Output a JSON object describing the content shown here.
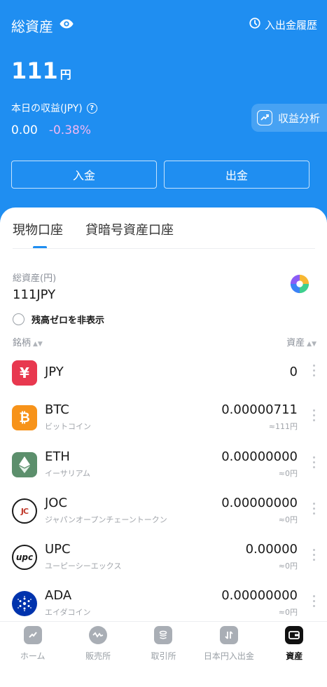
{
  "header": {
    "title": "総資産",
    "history_label": "入出金履歴",
    "balance": "111",
    "balance_unit": "円",
    "pl_label": "本日の収益(JPY)",
    "pl_value": "0.00",
    "pl_rate": "-0.38%",
    "analysis_label": "収益分析",
    "deposit_label": "入金",
    "withdraw_label": "出金"
  },
  "tabs": [
    "現物口座",
    "貸暗号資産口座"
  ],
  "summary": {
    "total_label": "総資産(円)",
    "total_value": "111JPY",
    "hide_zero_label": "残高ゼロを非表示"
  },
  "columns": {
    "name": "銘柄",
    "asset": "資産"
  },
  "assets": [
    {
      "symbol": "JPY",
      "name": "",
      "amount": "0",
      "fiat": "",
      "icon": "yen-icon",
      "color": "#e8384f"
    },
    {
      "symbol": "BTC",
      "name": "ビットコイン",
      "amount": "0.00000711",
      "fiat": "≈111円",
      "icon": "bitcoin-icon",
      "color": "#f7931a"
    },
    {
      "symbol": "ETH",
      "name": "イーサリアム",
      "amount": "0.00000000",
      "fiat": "≈0円",
      "icon": "ethereum-icon",
      "color": "#5c8f6c"
    },
    {
      "symbol": "JOC",
      "name": "ジャパンオープンチェーントークン",
      "amount": "0.00000000",
      "fiat": "≈0円",
      "icon": "joc-icon",
      "color": "#1a1a1a"
    },
    {
      "symbol": "UPC",
      "name": "ユーピーシーエックス",
      "amount": "0.00000",
      "fiat": "≈0円",
      "icon": "upc-icon",
      "color": "#1a1a1a"
    },
    {
      "symbol": "ADA",
      "name": "エイダコイン",
      "amount": "0.00000000",
      "fiat": "≈0円",
      "icon": "cardano-icon",
      "color": "#0033ad"
    }
  ],
  "nav": [
    {
      "label": "ホーム",
      "icon": "home-icon",
      "active": false
    },
    {
      "label": "販売所",
      "icon": "exchange-shop-icon",
      "active": false
    },
    {
      "label": "取引所",
      "icon": "trading-icon",
      "active": false
    },
    {
      "label": "日本円入出金",
      "icon": "deposit-icon",
      "active": false
    },
    {
      "label": "資産",
      "icon": "wallet-icon",
      "active": true
    }
  ]
}
